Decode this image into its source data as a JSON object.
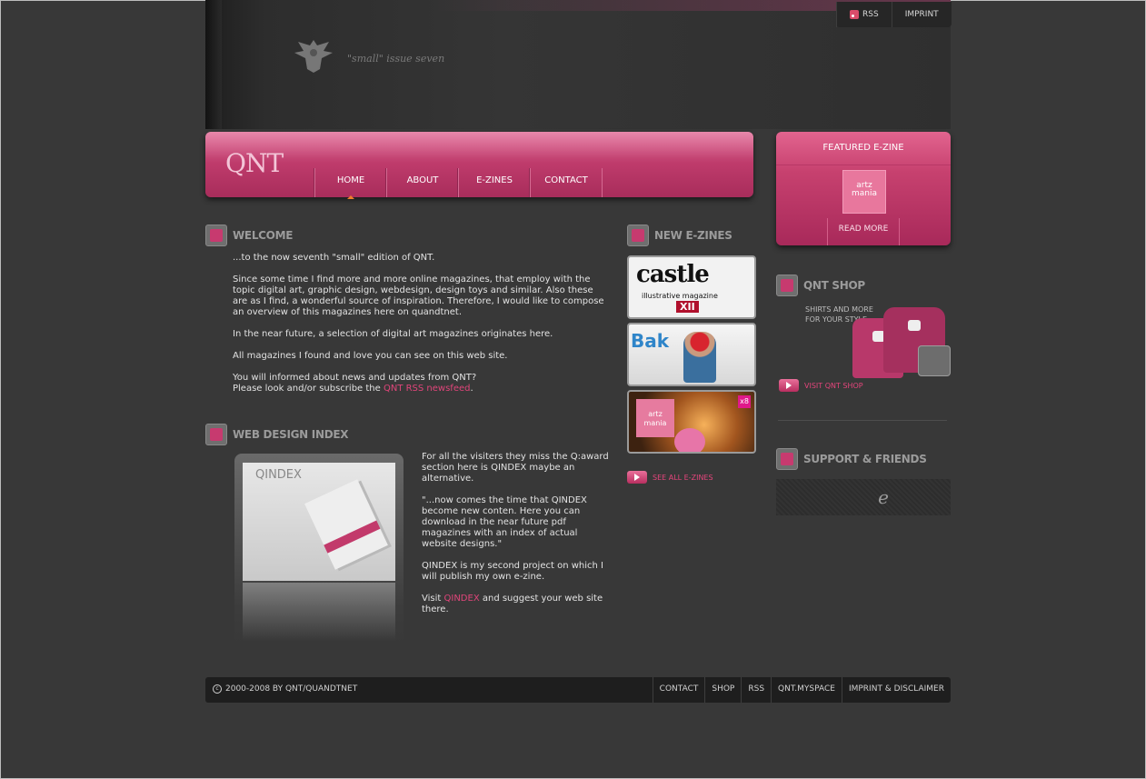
{
  "header": {
    "issue": "\"small\" issue seven",
    "toplinks": {
      "rss": "RSS",
      "imprint": "IMPRINT"
    }
  },
  "nav": {
    "logo": "QNT",
    "items": [
      {
        "label": "HOME",
        "active": true
      },
      {
        "label": "ABOUT"
      },
      {
        "label": "E-ZINES"
      },
      {
        "label": "CONTACT"
      }
    ]
  },
  "featured": {
    "title": "FEATURED E-ZINE",
    "logo_text": "artz mania",
    "read_more": "READ MORE"
  },
  "welcome": {
    "title": "WELCOME",
    "p1": "...to the now seventh \"small\" edition of QNT.",
    "p2": "Since some time I find more and more online magazines, that employ with the topic digital art, graphic design, webdesign, design toys and similar. Also these are as I find, a wonderful source of inspiration. Therefore, I would like to compose an overview of this magazines here on quandtnet.",
    "p3": "In the near future, a selection of digital art magazines originates here.",
    "p4": "All magazines I found and love you can see on this web site.",
    "p5a": "You will informed about news and updates from QNT?",
    "p5b": "Please look and/or subscribe the ",
    "p5_link": "QNT RSS newsfeed",
    "p5_end": "."
  },
  "webdesign": {
    "title": "WEB DESIGN INDEX",
    "image_title": "QINDEX",
    "p1": "For all the visiters they miss the Q:award section here is QINDEX maybe an alternative.",
    "p2": "\"...now comes the time that QINDEX become new conten. Here you can download in the near future pdf magazines with an index of actual website designs.\"",
    "p3": "QINDEX is my second project on which I will publish my own e-zine.",
    "p4a": "Visit ",
    "p4_link": "QINDEX",
    "p4b": " and suggest your web site there."
  },
  "ezines": {
    "title": "NEW E-ZINES",
    "items": [
      {
        "title": "castle",
        "sub": "illustrative magazine",
        "badge": "XII"
      },
      {
        "title": "Bak"
      },
      {
        "title": "artz mania",
        "badge": "x8"
      }
    ],
    "see_all": "SEE ALL E-ZINES"
  },
  "shop": {
    "title": "QNT SHOP",
    "sub1": "SHIRTS AND MORE",
    "sub2": "FOR YOUR STYLE",
    "visit": "VISIT QNT SHOP"
  },
  "friends": {
    "title": "SUPPORT & FRIENDS",
    "items": [
      "",
      "",
      "e"
    ]
  },
  "footer": {
    "copyright": "2000-2008 BY QNT/QUANDTNET",
    "links": [
      "CONTACT",
      "SHOP",
      "RSS",
      "QNT.MYSPACE",
      "IMPRINT & DISCLAIMER"
    ]
  },
  "colors": {
    "accent": "#c23d6e",
    "link": "#e0457a",
    "background": "#383838"
  }
}
